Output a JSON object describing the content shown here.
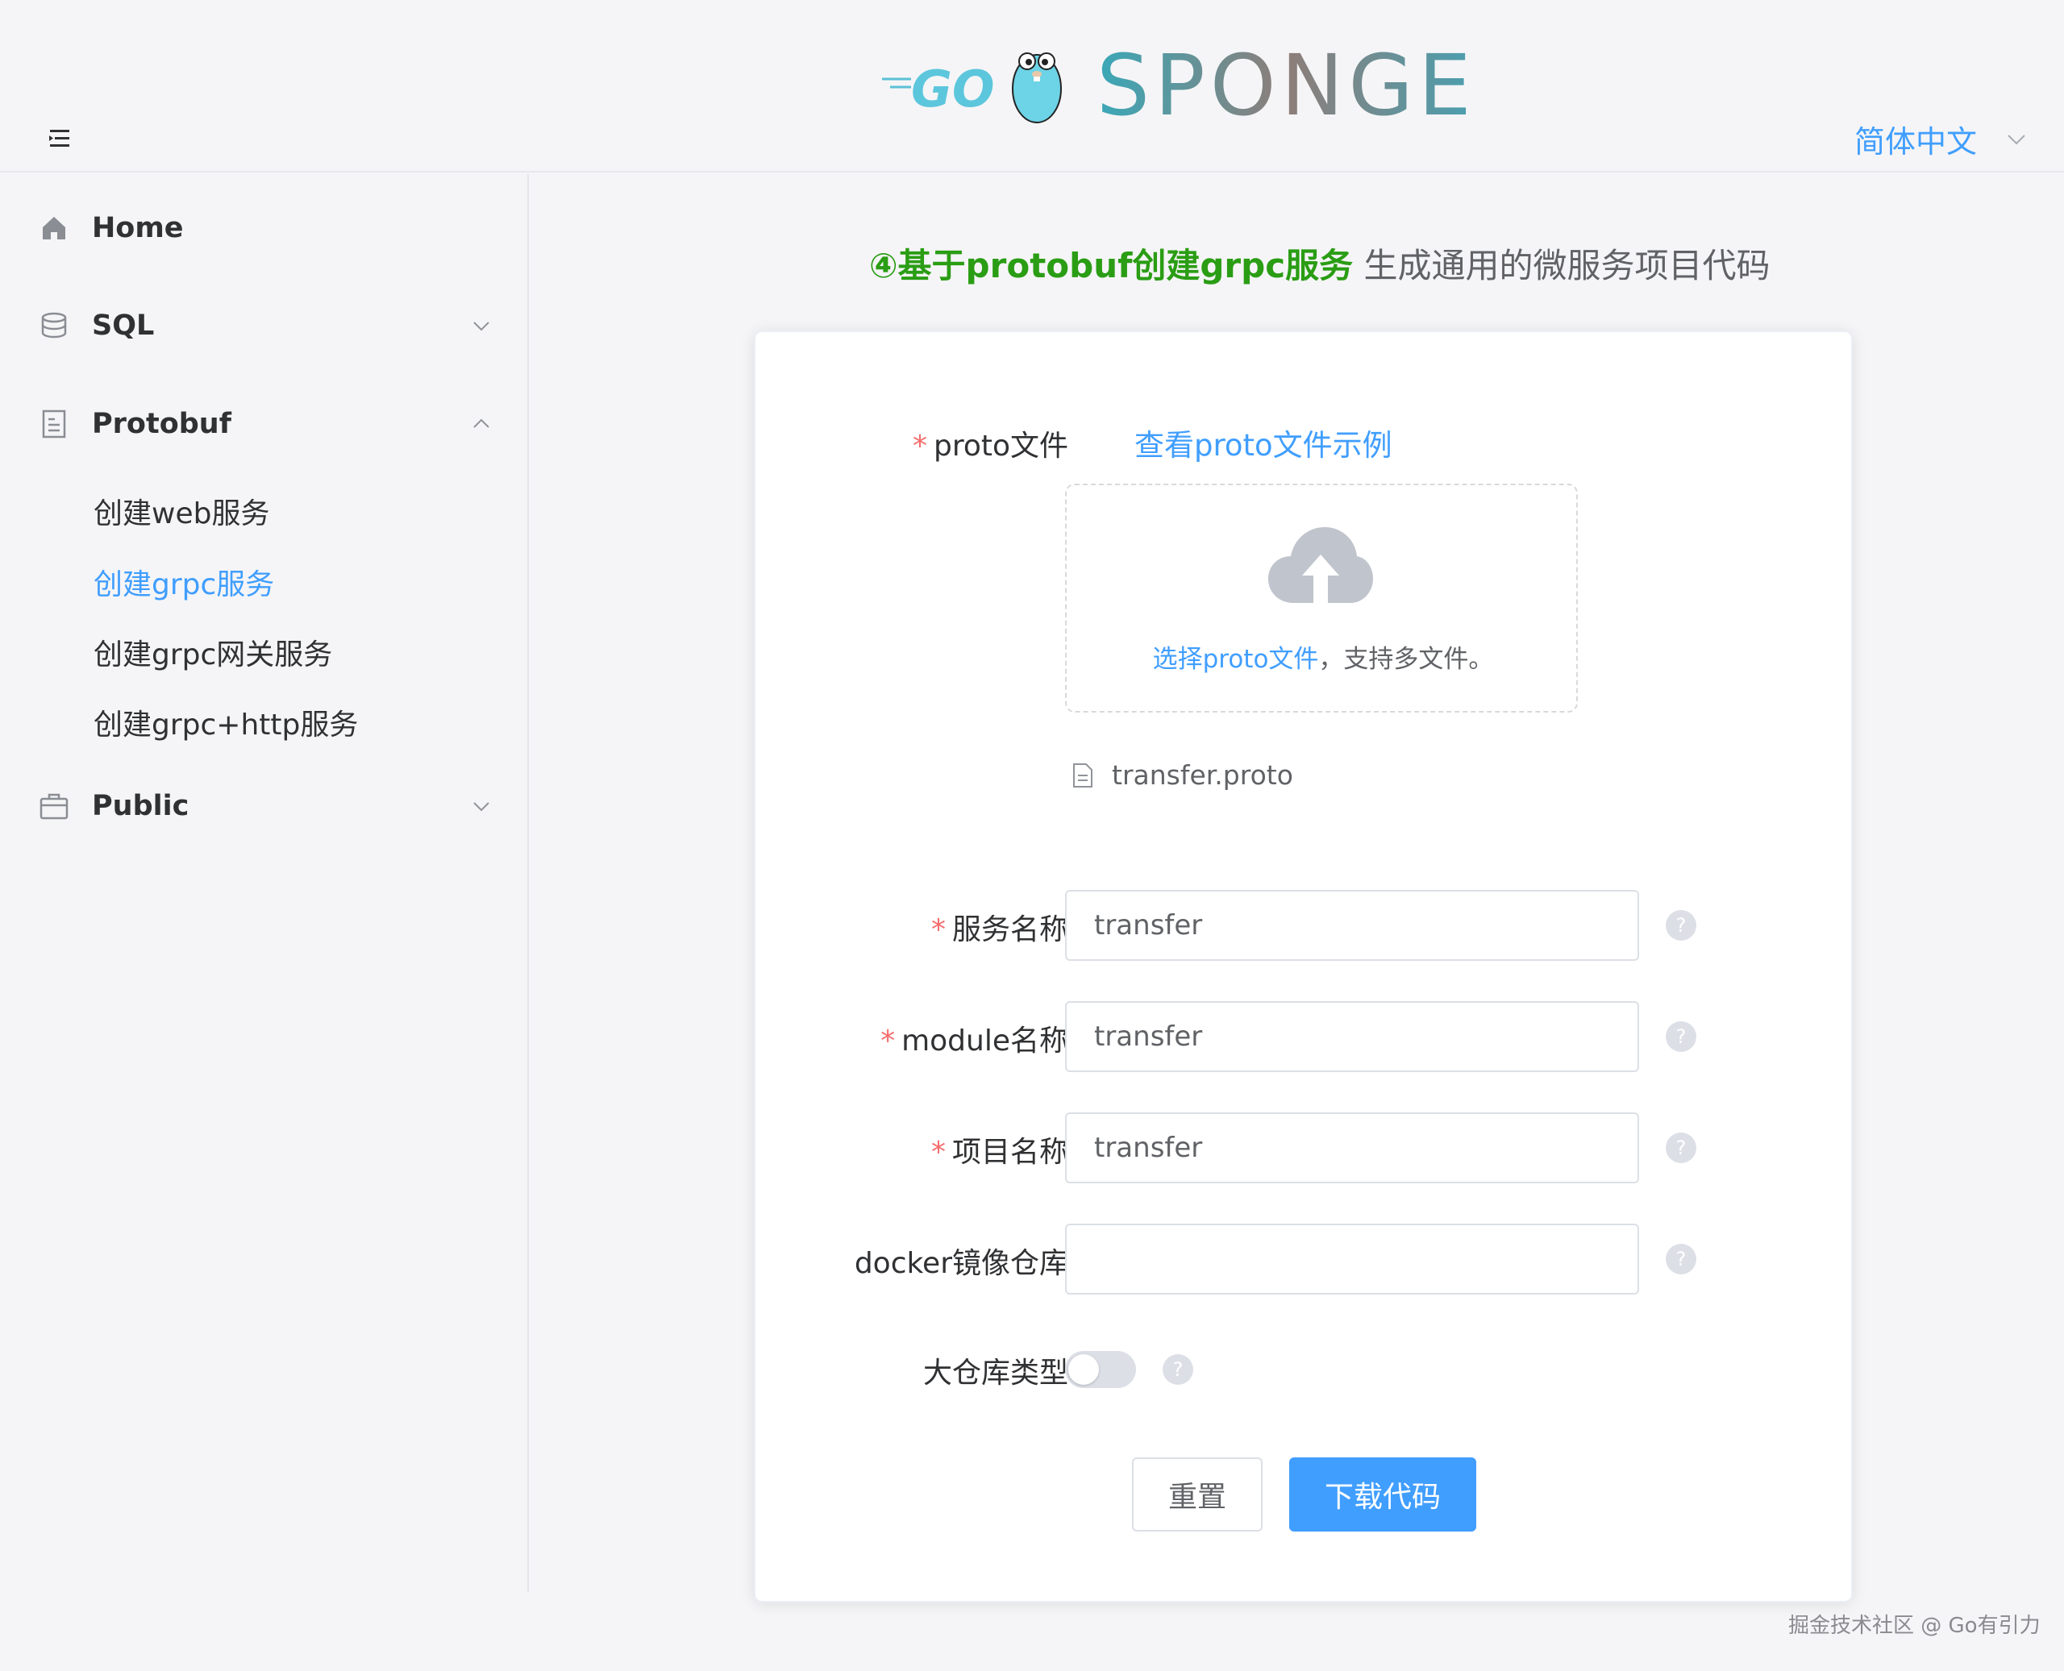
{
  "header": {
    "logo_go": "GO",
    "logo_text": "SPONGE",
    "language": "简体中文"
  },
  "sidebar": {
    "items": [
      {
        "label": "Home",
        "icon": "home-icon"
      },
      {
        "label": "SQL",
        "icon": "database-icon"
      },
      {
        "label": "Protobuf",
        "icon": "document-icon"
      },
      {
        "label": "Public",
        "icon": "briefcase-icon"
      }
    ],
    "protobuf_children": [
      {
        "label": "创建web服务",
        "active": false
      },
      {
        "label": "创建grpc服务",
        "active": true
      },
      {
        "label": "创建grpc网关服务",
        "active": false
      },
      {
        "label": "创建grpc+http服务",
        "active": false
      }
    ]
  },
  "main": {
    "title_highlight": "④基于protobuf创建grpc服务",
    "title_rest": " 生成通用的微服务项目代码",
    "form": {
      "proto_label": "proto文件",
      "proto_example_link": "查看proto文件示例",
      "upload_hint_link": "选择proto文件",
      "upload_hint_rest": "，支持多文件。",
      "uploaded_file": "transfer.proto",
      "service_name_label": "服务名称",
      "service_name_value": "transfer",
      "module_name_label": "module名称",
      "module_name_value": "transfer",
      "project_name_label": "项目名称",
      "project_name_value": "transfer",
      "docker_label": "docker镜像仓库",
      "docker_value": "",
      "monorepo_label": "大仓库类型",
      "reset_button": "重置",
      "download_button": "下载代码"
    }
  },
  "footer": {
    "watermark": "掘金技术社区 @ Go有引力"
  },
  "colors": {
    "accent": "#409eff",
    "highlight_green": "#2a9d14",
    "required": "#f56c6c"
  }
}
